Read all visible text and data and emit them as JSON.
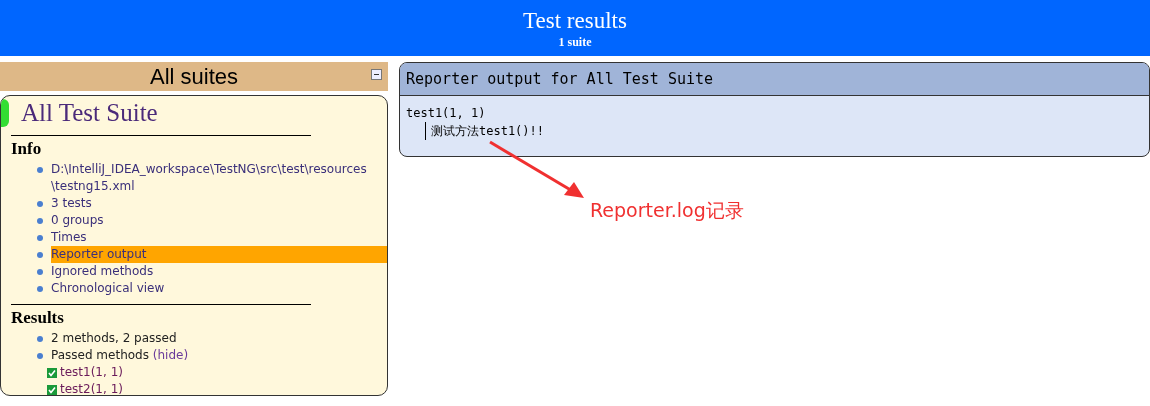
{
  "header": {
    "title": "Test results",
    "subtitle": "1 suite"
  },
  "sidebar": {
    "title": "All suites",
    "suite": {
      "name": "All Test Suite",
      "info": {
        "heading": "Info",
        "items": [
          {
            "label": "D:\\IntelliJ_IDEA_workspace\\TestNG\\src\\test\\resources\\testng15.xml",
            "selected": false
          },
          {
            "label": "3 tests",
            "selected": false
          },
          {
            "label": "0 groups",
            "selected": false
          },
          {
            "label": "Times",
            "selected": false
          },
          {
            "label": "Reporter output",
            "selected": true
          },
          {
            "label": "Ignored methods",
            "selected": false
          },
          {
            "label": "Chronological view",
            "selected": false
          }
        ]
      },
      "results": {
        "heading": "Results",
        "summary": "2 methods, 2 passed",
        "passed_label": "Passed methods",
        "hide_link": "(hide)",
        "methods": [
          {
            "name": "test1(1, 1)",
            "checked": true
          },
          {
            "name": "test2(1, 1)",
            "checked": true
          }
        ]
      }
    }
  },
  "reporter": {
    "title": "Reporter output for All Test Suite",
    "test": "test1(1, 1)",
    "lines": [
      "测试方法test1()!!"
    ]
  },
  "annotation": {
    "text": "Reporter.log记录"
  }
}
